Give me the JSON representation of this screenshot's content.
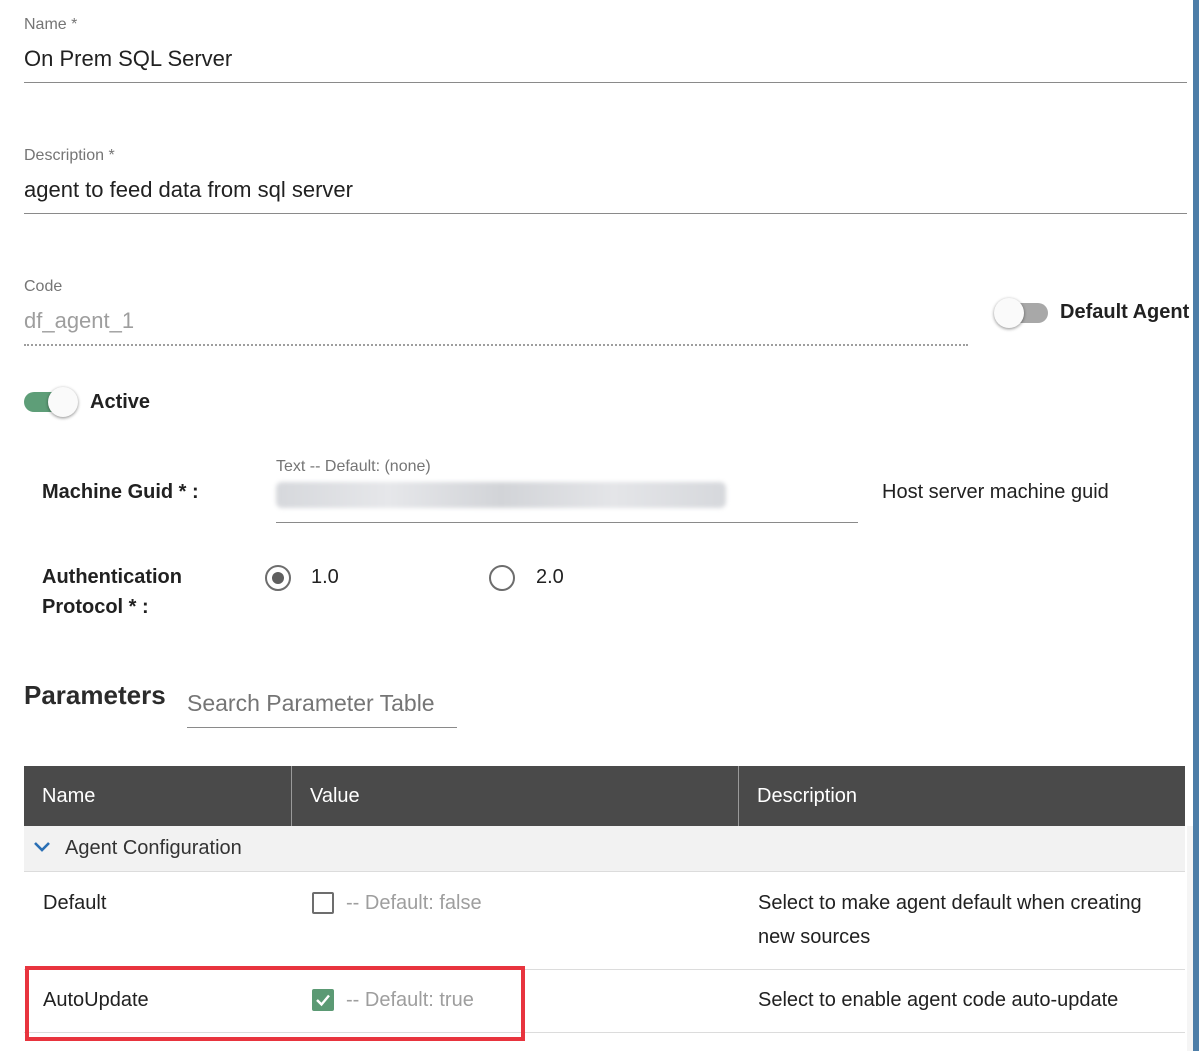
{
  "form": {
    "name_label": "Name *",
    "name_value": "On Prem SQL Server",
    "description_label": "Description *",
    "description_value": "agent to feed data from sql server",
    "code_label": "Code",
    "code_value": "df_agent_1",
    "default_agent_label": "Default Agent",
    "default_agent_on": false,
    "active_label": "Active",
    "active_on": true,
    "machine_guid_label": "Machine Guid * :",
    "machine_guid_hint": "Text -- Default: (none)",
    "machine_guid_description": "Host server machine guid",
    "auth_label_line1": "Authentication",
    "auth_label_line2": "Protocol * :",
    "auth_options": [
      {
        "label": "1.0",
        "selected": true
      },
      {
        "label": "2.0",
        "selected": false
      }
    ]
  },
  "parameters": {
    "title": "Parameters",
    "search_placeholder": "Search Parameter Table",
    "columns": [
      "Name",
      "Value",
      "Description"
    ],
    "group": "Agent Configuration",
    "rows": [
      {
        "name": "Default",
        "checked": false,
        "default_text": "-- Default: false",
        "description_line1": "Select to make agent default when creating",
        "description_line2": "new sources"
      },
      {
        "name": "AutoUpdate",
        "checked": true,
        "default_text": "-- Default: true",
        "description_line1": "Select to enable agent code auto-update"
      }
    ]
  },
  "colors": {
    "toggle_active": "#5e9e78",
    "checkbox_checked": "#5b9a74",
    "highlight_box": "#e8343e",
    "header_bg": "#4a4a4a"
  }
}
